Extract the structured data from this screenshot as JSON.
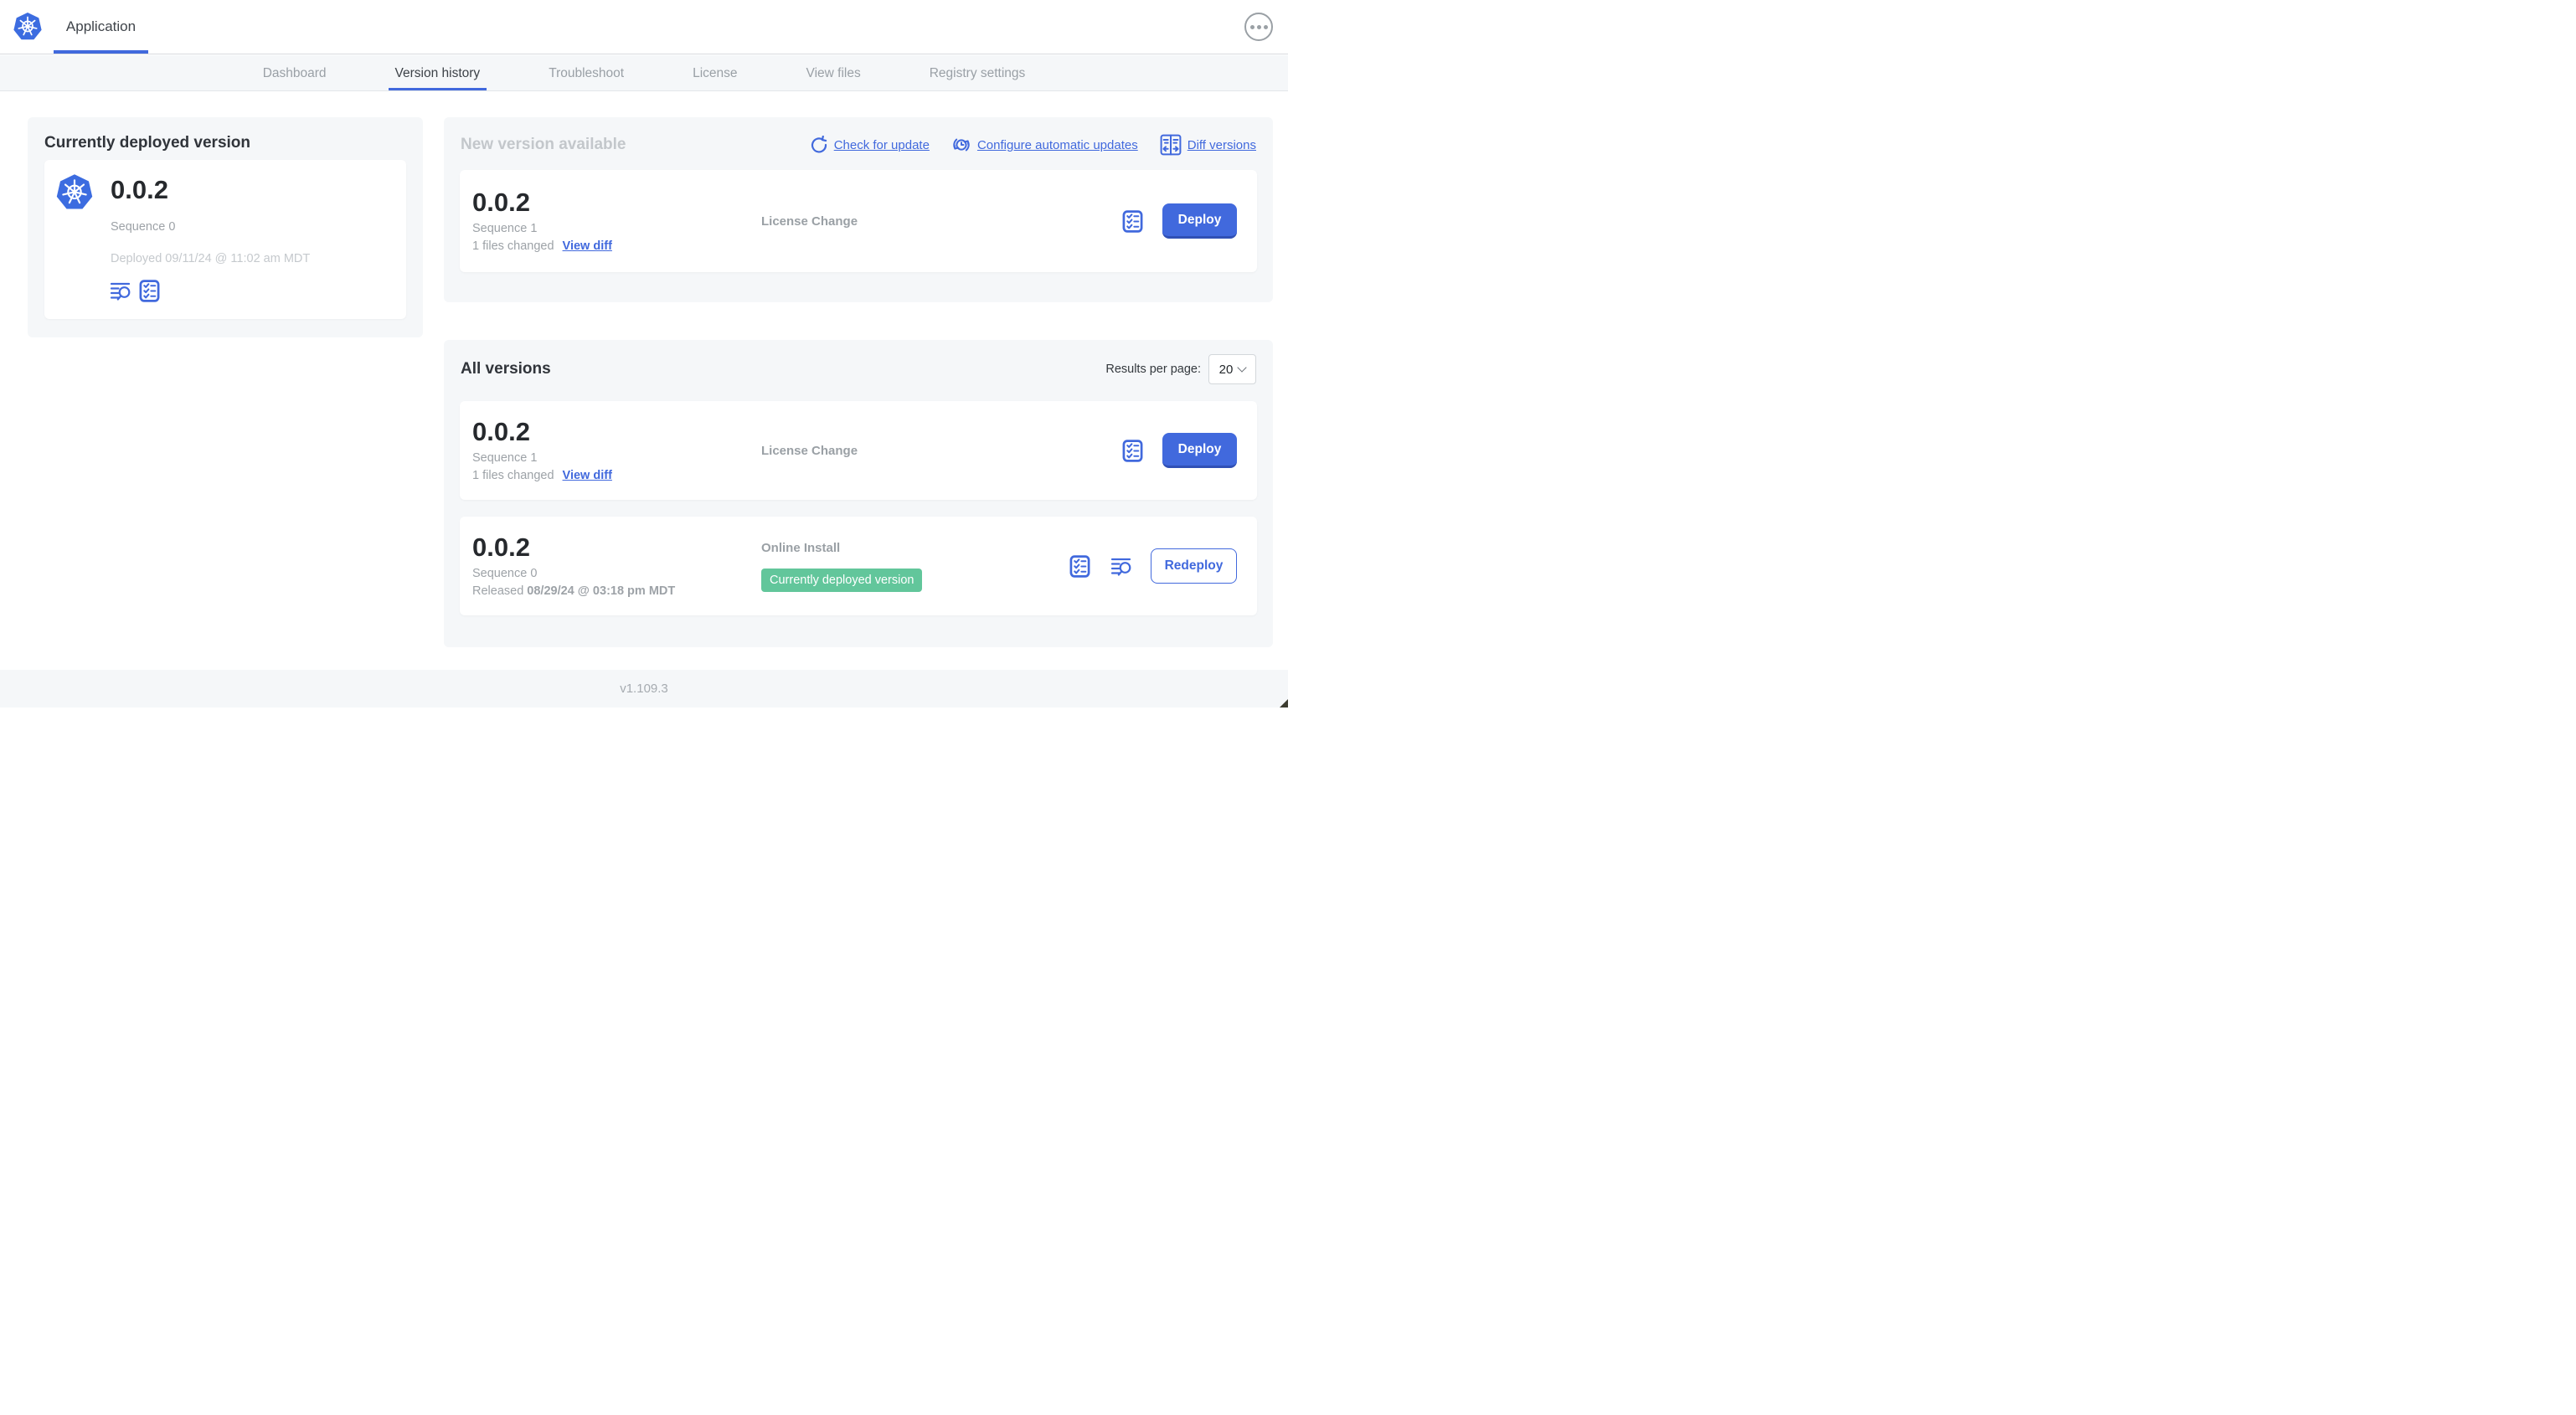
{
  "colors": {
    "blue": "#4169dd",
    "blue-dark": "#3050b5",
    "green": "#62c69b",
    "panel": "#f5f7f9",
    "border": "#e3e6e9",
    "text-dark": "#33373c",
    "text-gray": "#9da2a7",
    "text-light": "#c5c9cd",
    "nav-inactive": "#9aa0a6"
  },
  "header": {
    "app_tab": "Application"
  },
  "nav": {
    "tabs": [
      {
        "label": "Dashboard"
      },
      {
        "label": "Version history"
      },
      {
        "label": "Troubleshoot"
      },
      {
        "label": "License"
      },
      {
        "label": "View files"
      },
      {
        "label": "Registry settings"
      }
    ]
  },
  "current": {
    "title": "Currently deployed version",
    "version": "0.0.2",
    "sequence": "Sequence 0",
    "deployed": "Deployed 09/11/24 @ 11:02 am MDT"
  },
  "new_version": {
    "heading": "New version available",
    "check_for_update": "Check for update",
    "configure_auto_updates": "Configure automatic updates",
    "diff_versions": "Diff versions",
    "row": {
      "version": "0.0.2",
      "sequence": "Sequence 1",
      "files_changed": "1 files changed",
      "view_diff": "View diff",
      "source": "License Change",
      "action": "Deploy"
    }
  },
  "all_versions": {
    "title": "All versions",
    "per_page_label": "Results per page:",
    "per_page_value": "20",
    "rows": [
      {
        "version": "0.0.2",
        "sequence": "Sequence 1",
        "files_changed": "1 files changed",
        "view_diff": "View diff",
        "source": "License Change",
        "action": "Deploy"
      },
      {
        "version": "0.0.2",
        "sequence": "Sequence 0",
        "released_prefix": "Released ",
        "released_date": "08/29/24 @ 03:18 pm MDT",
        "source": "Online Install",
        "badge": "Currently deployed version",
        "action": "Redeploy"
      }
    ]
  },
  "footer": {
    "version": "v1.109.3"
  }
}
